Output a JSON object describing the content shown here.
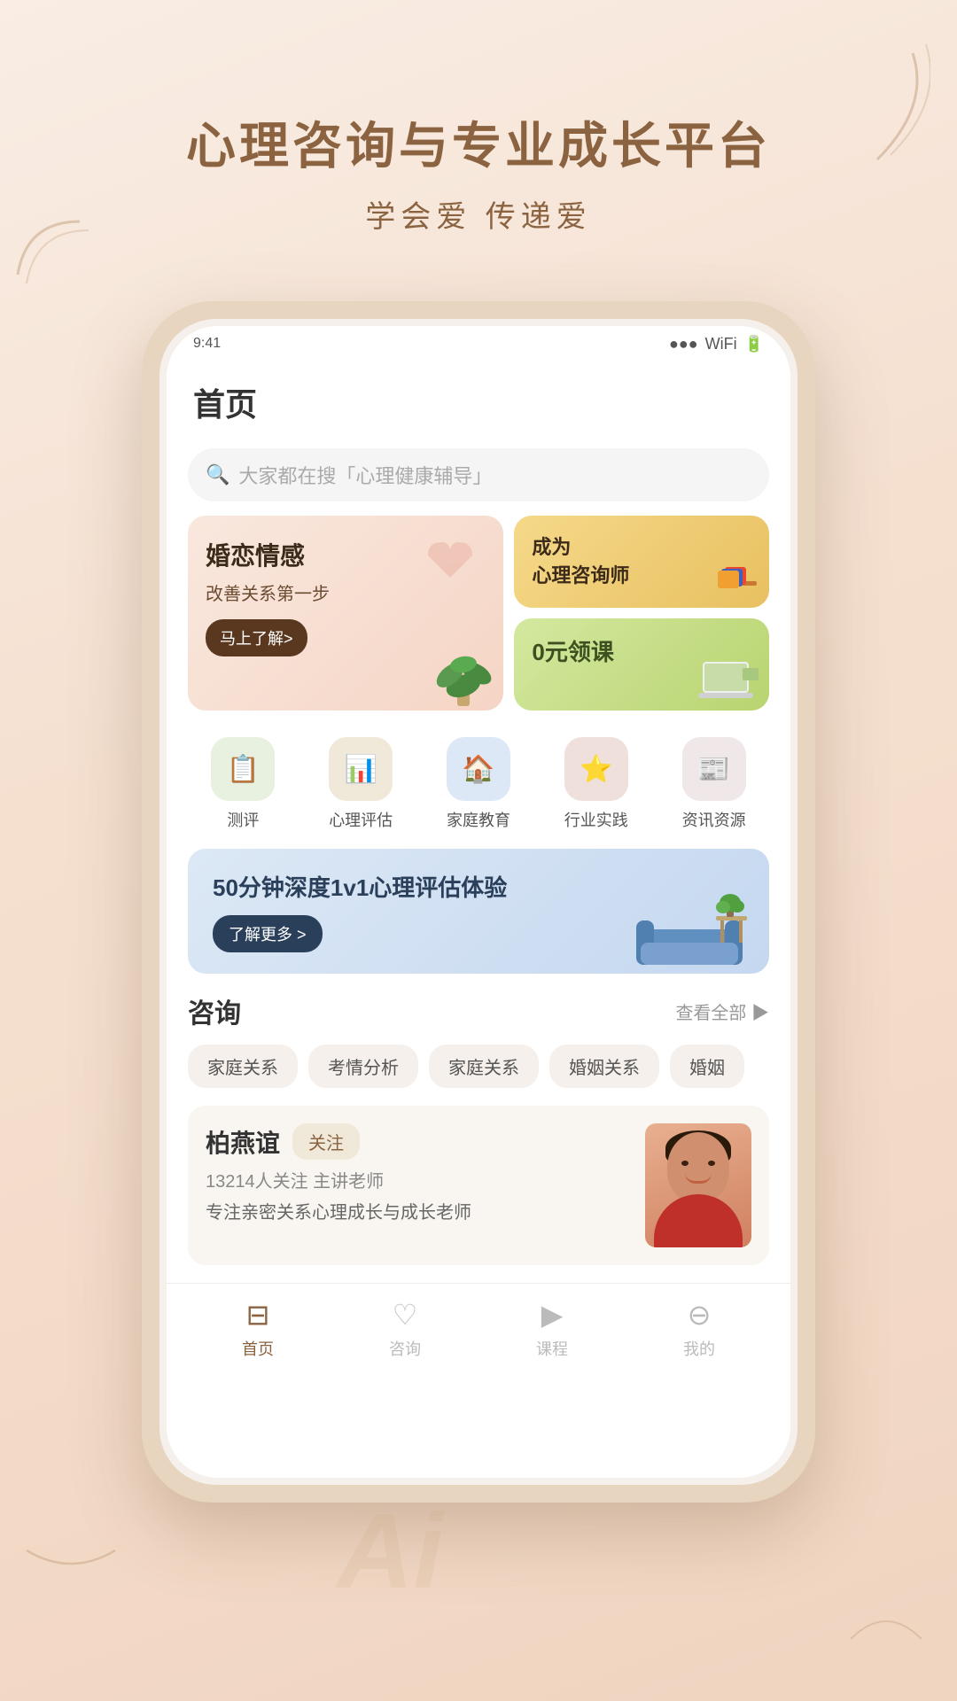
{
  "app": {
    "tagline_main": "心理咨询与专业成长平台",
    "tagline_sub": "学会爱  传递爱"
  },
  "nav": {
    "title": "首页"
  },
  "search": {
    "placeholder": "大家都在搜「心理健康辅导」"
  },
  "banners": {
    "left": {
      "title": "婚恋情感",
      "subtitle": "改善关系第一步",
      "button": "马上了解>"
    },
    "right_top": {
      "line1": "成为",
      "line2": "心理咨询师"
    },
    "right_bottom": {
      "text": "0元领课"
    }
  },
  "icons": [
    {
      "label": "测评",
      "bg": "#e8f0e0",
      "emoji": "📋"
    },
    {
      "label": "心理评估",
      "bg": "#f0e8d8",
      "emoji": "📊"
    },
    {
      "label": "家庭教育",
      "bg": "#dce8f5",
      "emoji": "🏠"
    },
    {
      "label": "行业实践",
      "bg": "#f0e0dc",
      "emoji": "⭐"
    },
    {
      "label": "资讯资源",
      "bg": "#f0e8e8",
      "emoji": "📰"
    }
  ],
  "blue_banner": {
    "title": "50分钟深度1v1心理评估体验",
    "button": "了解更多 >"
  },
  "consultation": {
    "section_title": "咨询",
    "more_text": "查看全部 ▶",
    "tags": [
      "家庭关系",
      "考情分析",
      "家庭关系",
      "婚姻关系",
      "婚姻"
    ],
    "consultant": {
      "name": "柏燕谊",
      "follow_label": "关注",
      "stats": "13214人关注  主讲老师",
      "desc": "专注亲密关系心理成长与成长老师"
    }
  },
  "bottom_nav": [
    {
      "label": "首页",
      "active": true
    },
    {
      "label": "咨询",
      "active": false
    },
    {
      "label": "课程",
      "active": false
    },
    {
      "label": "我的",
      "active": false
    }
  ]
}
